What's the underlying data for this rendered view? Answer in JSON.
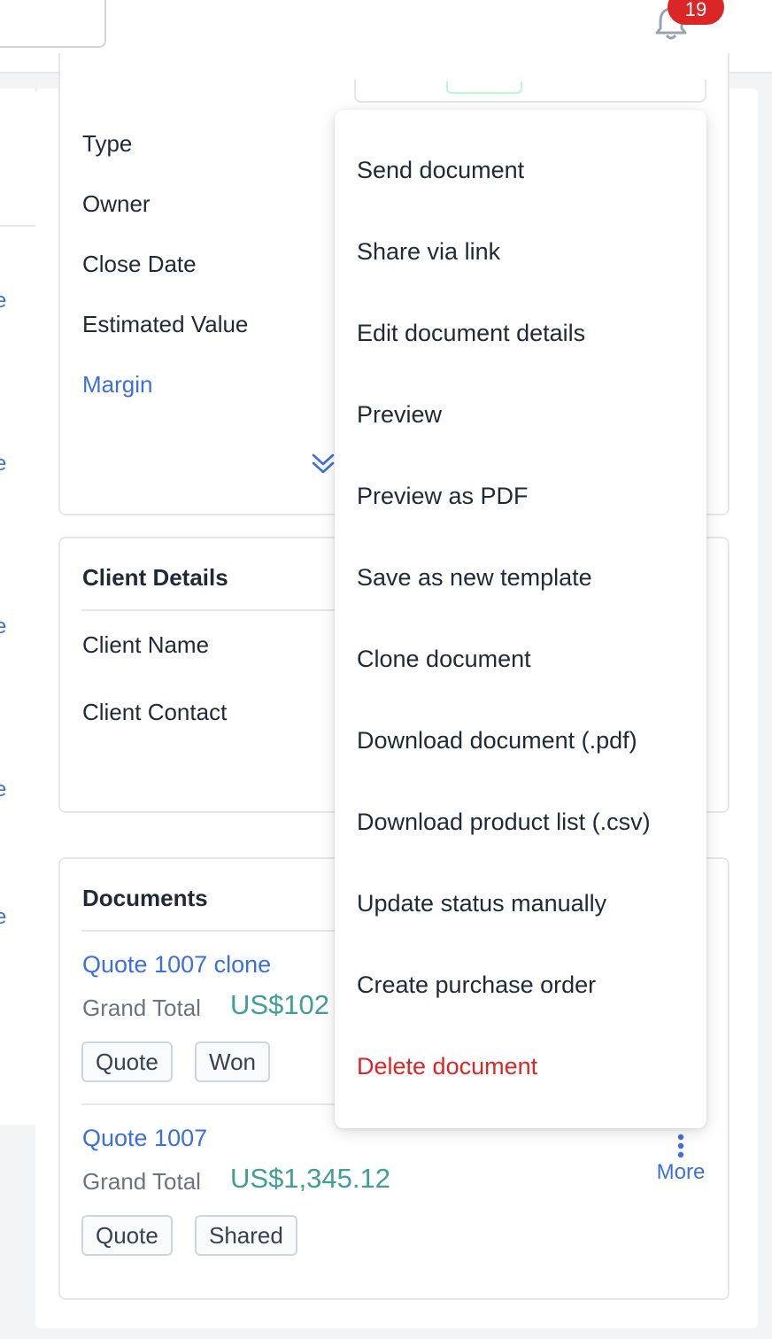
{
  "header": {
    "notification_count": "19"
  },
  "details": {
    "fields": [
      "Type",
      "Owner",
      "Close Date",
      "Estimated Value",
      "Margin"
    ]
  },
  "client": {
    "title": "Client Details",
    "fields": [
      "Client Name",
      "Client Contact"
    ]
  },
  "documents": {
    "title": "Documents",
    "items": [
      {
        "name": "Quote 1007 clone",
        "grand_total_label": "Grand Total",
        "grand_total": "US$102",
        "tags": [
          "Quote",
          "Won"
        ]
      },
      {
        "name": "Quote 1007",
        "grand_total_label": "Grand Total",
        "grand_total": "US$1,345.12",
        "tags": [
          "Quote",
          "Shared"
        ]
      }
    ],
    "more_label": "More"
  },
  "menu": {
    "items": [
      "Send document",
      "Share via link",
      "Edit document details",
      "Preview",
      "Preview as PDF",
      "Save as new template",
      "Clone document",
      "Download document (.pdf)",
      "Download product list (.csv)",
      "Update status manually",
      "Create purchase order",
      "Delete document"
    ]
  },
  "colors": {
    "link": "#3b6fe0",
    "money": "#3f9f96",
    "danger": "#dc2626",
    "badge": "#dc2626"
  },
  "icons": [
    "bell-icon",
    "double-chevron-down-icon",
    "vertical-dots-icon"
  ]
}
